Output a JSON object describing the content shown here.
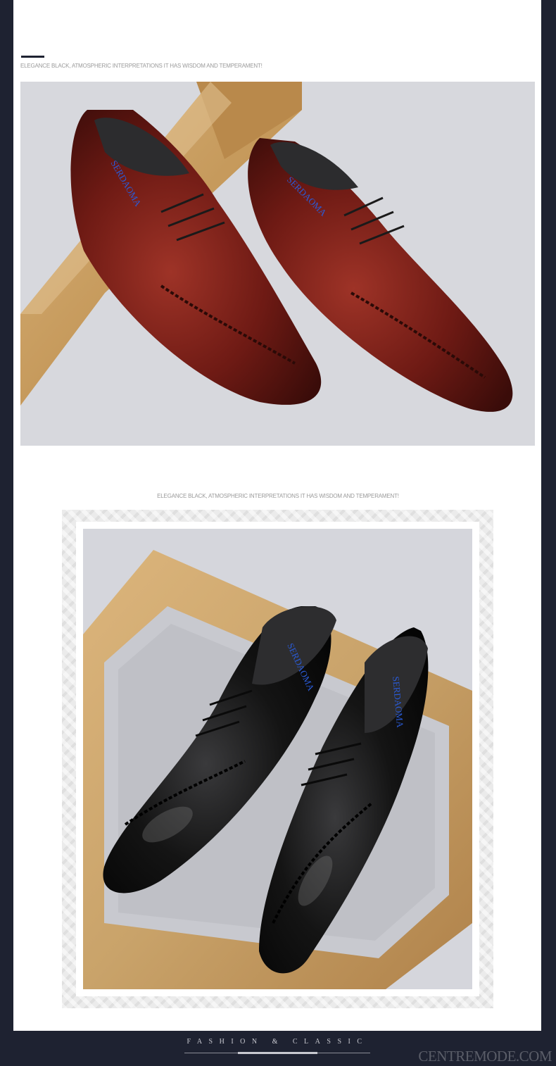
{
  "section_caption_top": "ELEGANCE BLACK, ATMOSPHERIC INTERPRETATIONS IT HAS WISDOM AND TEMPERAMENT!",
  "section_caption_middle": "ELEGANCE BLACK, ATMOSPHERIC INTERPRETATIONS IT HAS WISDOM AND TEMPERAMENT!",
  "shoe_brand_insole": "SERDAOMA",
  "footer": {
    "title": "FASHION & CLASSIC"
  },
  "watermark": "CENTREMODE.COM",
  "colors": {
    "page_background": "#1e2231",
    "panel_background": "#ffffff",
    "accent": "#1e2231",
    "burgundy_leather": "#6e1a14",
    "black_leather": "#141414",
    "frame_wood": "#c9a36a",
    "insole_text": "#2a5bd7"
  }
}
